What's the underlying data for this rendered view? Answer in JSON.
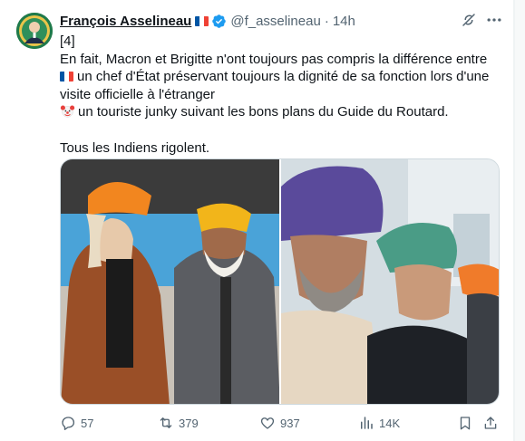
{
  "tweet": {
    "author_name": "François Asselineau",
    "handle": "@f_asselineau",
    "separator": "·",
    "time": "14h",
    "text_lines": [
      "[4]",
      "En fait, Macron et Brigitte n'ont toujours pas compris la différence entre",
      "un chef d'État préservant toujours la dignité de sa fonction lors d'une",
      "visite officielle à l'étranger",
      "un touriste junky suivant les bons plans du Guide du Routard.",
      "",
      "Tous les Indiens rigolent."
    ]
  },
  "actions": {
    "replies": "57",
    "reposts": "379",
    "likes": "937",
    "views": "14K"
  },
  "colors": {
    "text": "#0f1419",
    "secondary": "#536471",
    "verified": "#1d9bf0",
    "border": "#cfd9de",
    "flag_blue": "#0055a4",
    "flag_white": "#ffffff",
    "flag_red": "#ef4135"
  },
  "icons": {
    "verified": "verified-badge-icon",
    "grok": "grok-icon",
    "more": "more-icon",
    "reply": "reply-icon",
    "repost": "repost-icon",
    "like": "like-icon",
    "views": "views-icon",
    "bookmark": "bookmark-icon",
    "share": "share-icon"
  }
}
